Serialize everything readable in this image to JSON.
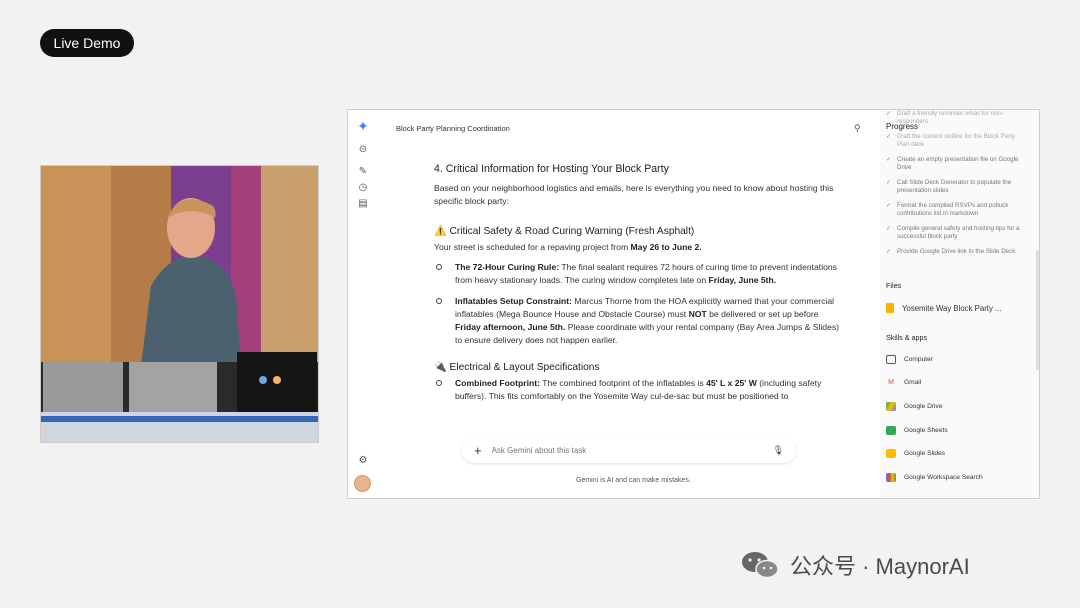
{
  "live_label": "Live Demo",
  "chat": {
    "title": "Block Party Planning Coordination",
    "section_heading": "4. Critical Information for Hosting Your Block Party",
    "intro": "Based on your neighborhood logistics and emails, here is everything you need to know about hosting this specific block party:",
    "safety_heading": "⚠️ Critical Safety & Road Curing Warning (Fresh Asphalt)",
    "street_text_pre": "Your street is scheduled for a repaving project from ",
    "street_text_bold": "May 26 to June 2.",
    "bullet1_title": "The 72-Hour Curing Rule:",
    "bullet1_text": " The final sealant requires 72 hours of curing time to prevent indentations from heavy stationary loads. The curing window completes late on ",
    "bullet1_bold": "Friday, June 5th.",
    "bullet2_title": "Inflatables Setup Constraint:",
    "bullet2_text1": " Marcus Thorne from the HOA explicitly warned that your commercial inflatables (Mega Bounce House and Obstacle Course) must ",
    "bullet2_not": "NOT",
    "bullet2_text2": " be delivered or set up before ",
    "bullet2_bold": "Friday afternoon, June 5th.",
    "bullet2_text3": " Please coordinate with your rental company (Bay Area Jumps & Slides) to ensure delivery does not happen earlier.",
    "electrical_heading": "🔌 Electrical & Layout Specifications",
    "bullet3_title": "Combined Footprint:",
    "bullet3_text1": " The combined footprint of the inflatables is ",
    "bullet3_bold": "45' L x 25' W",
    "bullet3_text2": " (including safety buffers). This fits comfortably on the Yosemite Way cul-de-sac but must be positioned to",
    "ask_placeholder": "Ask Gemini about this task",
    "disclaimer": "Gemini is AI and can make mistakes."
  },
  "side": {
    "progress_title": "Progress",
    "tasks": [
      "Draft a friendly reminder email for non-responders",
      "Draft the content outline for the Block Party Plan deck",
      "Create an empty presentation file on Google Drive",
      "Call Slide Deck Generator to populate the presentation slides",
      "Format the compiled RSVPs and potluck contributions list in markdown",
      "Compile general safety and hosting tips for a successful block party",
      "Provide Google Drive link to the Slide Deck"
    ],
    "files_title": "Files",
    "file_name": "Yosemite Way Block Party ...",
    "skills_title": "Skills & apps",
    "apps": [
      "Computer",
      "Gmail",
      "Google Drive",
      "Google Sheets",
      "Google Slides",
      "Google Workspace Search"
    ]
  },
  "watermark": "公众号 · MaynorAI",
  "colors": {
    "accent": "#4285f4",
    "pill": "#111111"
  }
}
